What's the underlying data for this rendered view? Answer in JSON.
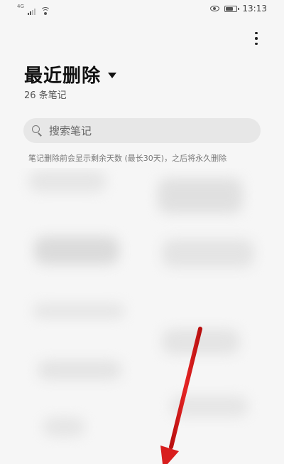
{
  "status_bar": {
    "network": "4G",
    "signal_level": 0.5,
    "battery_level": 0.75,
    "time": "13:13",
    "icons": [
      "signal-icon",
      "wifi-icon",
      "eye-icon",
      "battery-icon"
    ]
  },
  "header": {
    "title": "最近删除",
    "note_count": "26 条笔记",
    "more_icon": "more-vertical-icon",
    "dropdown_icon": "caret-down-icon"
  },
  "search": {
    "placeholder": "搜索笔记",
    "icon": "search-icon"
  },
  "info": {
    "text": "笔记删除前会显示剩余天数 (最长30天)，之后将永久删除"
  },
  "colors": {
    "background": "#f6f6f6",
    "search_bg": "#e7e7e7",
    "annotation_arrow": "#d81e1e"
  }
}
